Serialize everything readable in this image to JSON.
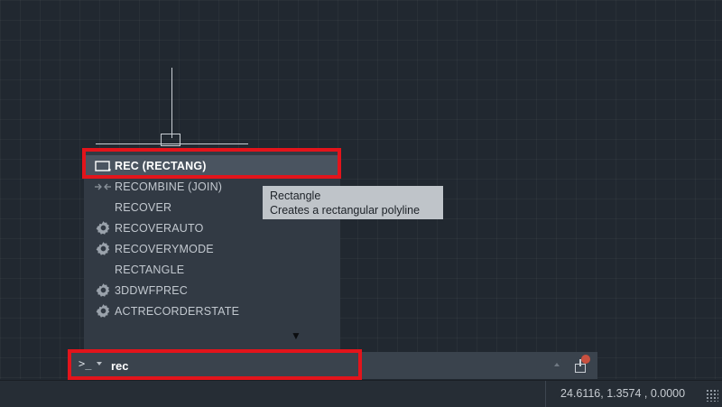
{
  "autocomplete": {
    "items": [
      {
        "label": "REC (RECTANG)",
        "icon": "rectangle-icon",
        "selected": true
      },
      {
        "label": "RECOMBINE (JOIN)",
        "icon": "join-icon"
      },
      {
        "label": "RECOVER",
        "icon": ""
      },
      {
        "label": "RECOVERAUTO",
        "icon": "gear-icon"
      },
      {
        "label": "RECOVERYMODE",
        "icon": "gear-icon"
      },
      {
        "label": "RECTANGLE",
        "icon": ""
      },
      {
        "label": "3DDWFPREC",
        "icon": "gear-icon"
      },
      {
        "label": "ACTRECORDERSTATE",
        "icon": "gear-icon"
      }
    ],
    "more_indicator": "▼"
  },
  "tooltip": {
    "title": "Rectangle",
    "description": "Creates a rectangular polyline"
  },
  "command_line": {
    "prompt": ">_",
    "value": "rec"
  },
  "status_bar": {
    "coordinates": "24.6116,  1.3574 , 0.0000"
  },
  "colors": {
    "highlight_box": "#e3141b",
    "canvas_bg": "#212830",
    "list_bg": "#323a44",
    "selected_bg": "#4a5460",
    "tooltip_bg": "#bfc4c9"
  }
}
